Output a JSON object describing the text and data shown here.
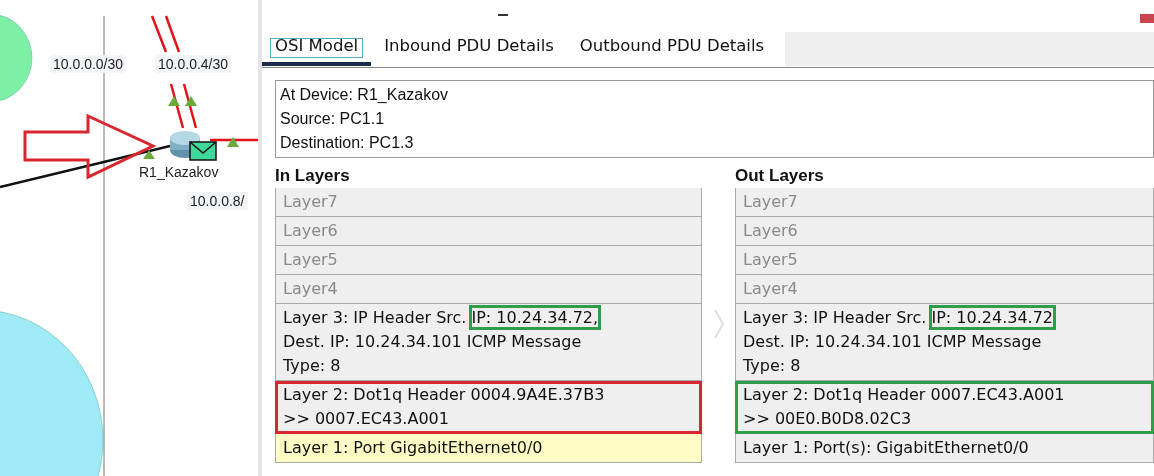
{
  "canvas": {
    "network_labels": [
      {
        "text": "10.0.0.0/30"
      },
      {
        "text": "10.0.0.4/30"
      },
      {
        "text": "10.0.0.8/"
      }
    ],
    "device": {
      "name": "R1_Kazakov",
      "has_pdu": true
    }
  },
  "tabs": [
    {
      "label": "OSI Model",
      "selected": true
    },
    {
      "label": "Inbound PDU Details",
      "selected": false
    },
    {
      "label": "Outbound PDU Details",
      "selected": false
    }
  ],
  "info": [
    "At Device: R1_Kazakov",
    "Source: PC1.1",
    "Destination: PC1.3"
  ],
  "columns": [
    {
      "heading": "In Layers",
      "layers": [
        {
          "lines": [
            [
              "Layer7"
            ]
          ],
          "enabled": false,
          "selected": false
        },
        {
          "lines": [
            [
              "Layer6"
            ]
          ],
          "enabled": false,
          "selected": false
        },
        {
          "lines": [
            [
              "Layer5"
            ]
          ],
          "enabled": false,
          "selected": false
        },
        {
          "lines": [
            [
              "Layer4"
            ]
          ],
          "enabled": false,
          "selected": false
        },
        {
          "lines": [
            [
              "Layer 3: IP Header Src. ",
              {
                "text": "IP: 10.24.34.72,",
                "color": "#2f9e4a"
              }
            ],
            [
              "Dest. IP: 10.24.34.101 ICMP Message"
            ],
            [
              "Type: 8"
            ]
          ],
          "enabled": true,
          "selected": false
        },
        {
          "lines": [
            [
              "Layer 2: Dot1q Header 0004.9A4E.37B3"
            ],
            [
              ">> 0007.EC43.A001"
            ]
          ],
          "enabled": true,
          "selected": false,
          "color": "#d9262e"
        },
        {
          "lines": [
            [
              "Layer 1: Port GigabitEthernet0/0"
            ]
          ],
          "enabled": true,
          "selected": true
        }
      ]
    },
    {
      "heading": "Out Layers",
      "layers": [
        {
          "lines": [
            [
              "Layer7"
            ]
          ],
          "enabled": false,
          "selected": false
        },
        {
          "lines": [
            [
              "Layer6"
            ]
          ],
          "enabled": false,
          "selected": false
        },
        {
          "lines": [
            [
              "Layer5"
            ]
          ],
          "enabled": false,
          "selected": false
        },
        {
          "lines": [
            [
              "Layer4"
            ]
          ],
          "enabled": false,
          "selected": false
        },
        {
          "lines": [
            [
              "Layer 3: IP Header Src. ",
              {
                "text": "IP: 10.24.34.72",
                "color": "#2f9e4a"
              }
            ],
            [
              "Dest. IP: 10.24.34.101 ICMP Message"
            ],
            [
              "Type: 8"
            ]
          ],
          "enabled": true,
          "selected": false
        },
        {
          "lines": [
            [
              "Layer 2: Dot1q Header 0007.EC43.A001"
            ],
            [
              ">> 00E0.B0D8.02C3"
            ]
          ],
          "enabled": true,
          "selected": false,
          "color": "#2f9e4a"
        },
        {
          "lines": [
            [
              "Layer 1: Port(s): GigabitEthernet0/0"
            ]
          ],
          "enabled": true,
          "selected": false
        }
      ]
    }
  ]
}
